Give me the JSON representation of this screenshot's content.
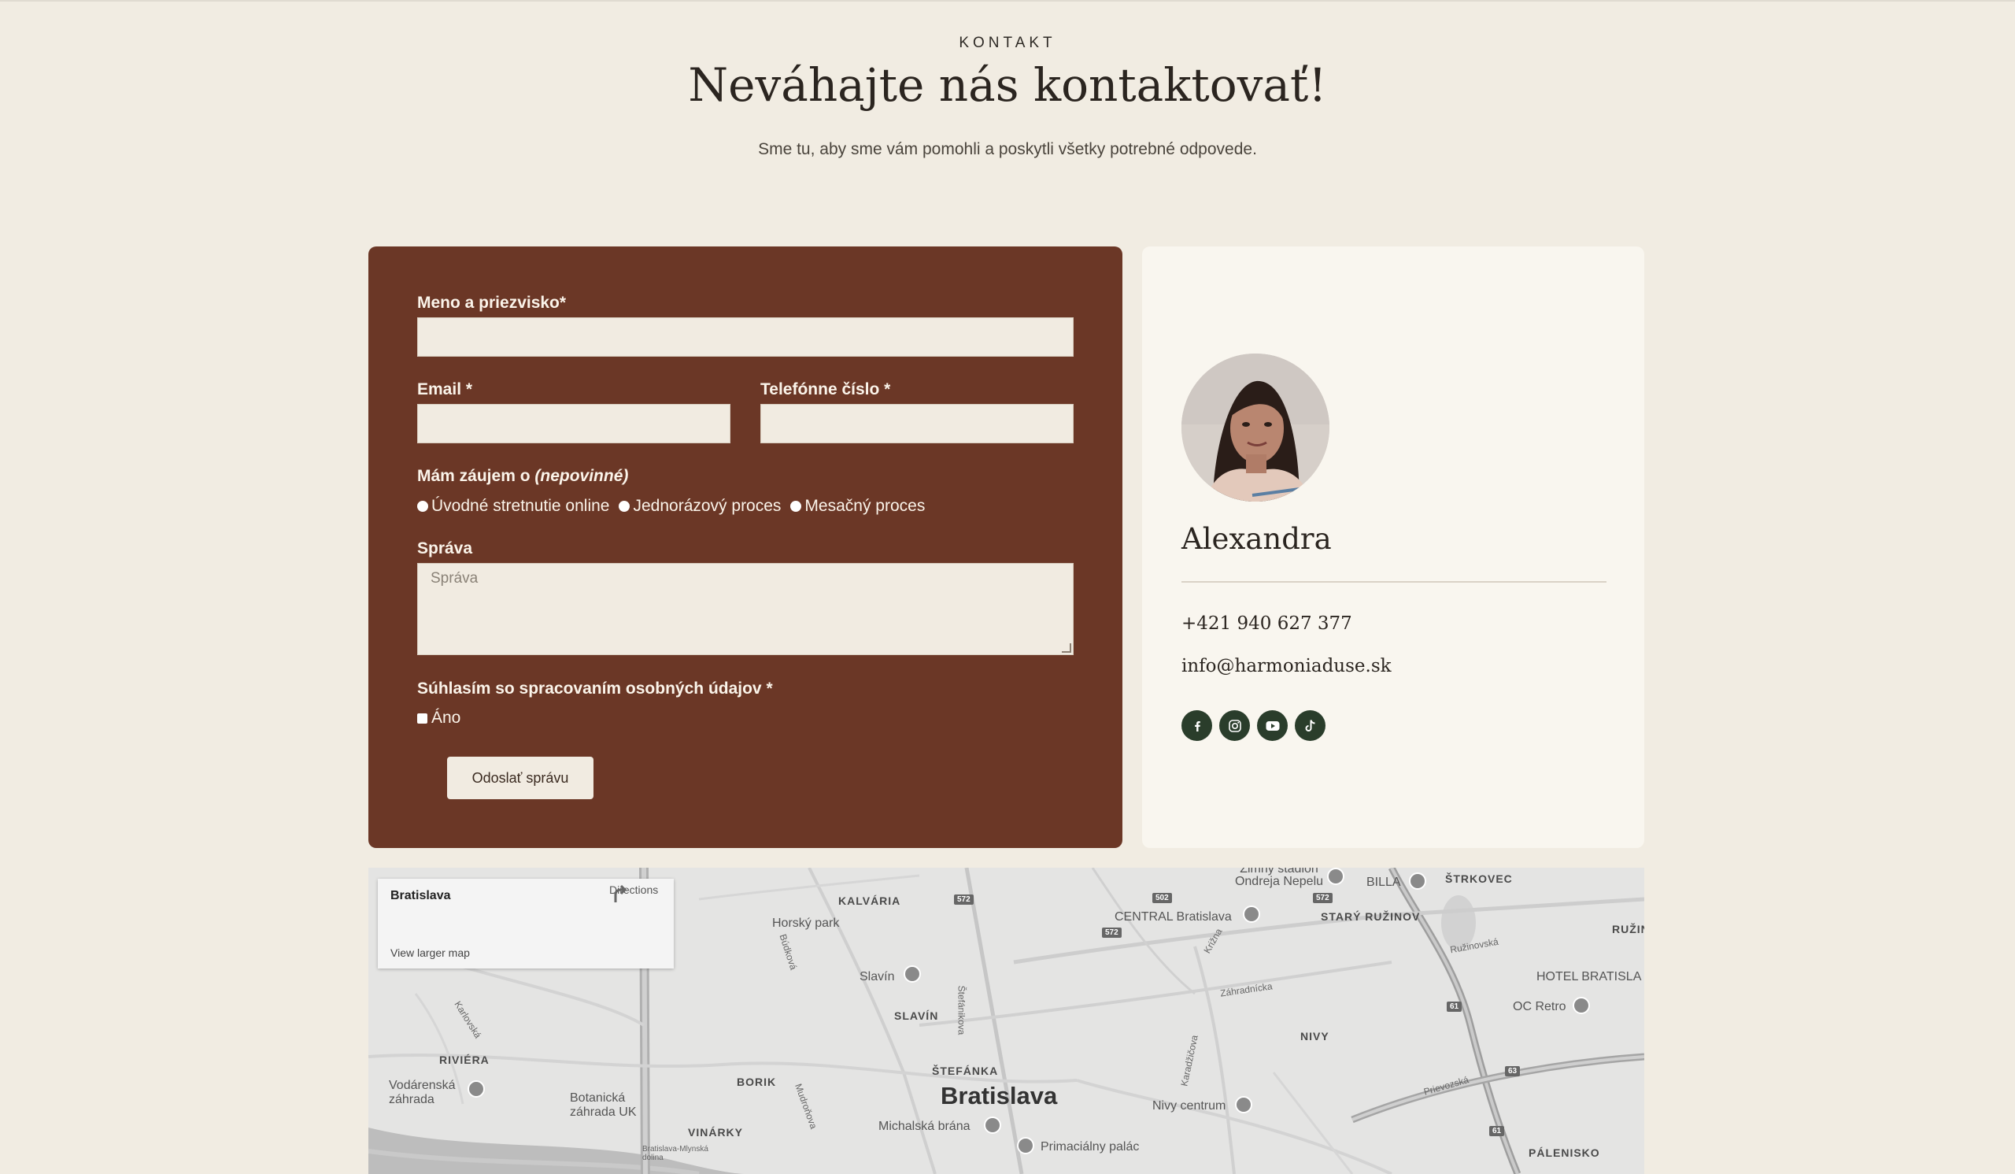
{
  "header": {
    "eyebrow": "KONTAKT",
    "title": "Neváhajte nás kontaktovať!",
    "subtitle": "Sme tu, aby sme vám pomohli a poskytli všetky potrebné odpovede."
  },
  "form": {
    "name_label": "Meno a priezvisko*",
    "name_value": "",
    "email_label": "Email *",
    "email_value": "",
    "phone_label": "Telefónne číslo *",
    "phone_value": "",
    "interest_label": "Mám záujem o",
    "interest_optional": "(nepovinné)",
    "interest_options": [
      "Úvodné stretnutie online",
      "Jednorázový proces",
      "Mesačný proces"
    ],
    "message_label": "Správa",
    "message_placeholder": "Správa",
    "consent_label": "Súhlasím so spracovaním osobných údajov *",
    "consent_option": "Áno",
    "submit_label": "Odoslať správu"
  },
  "profile": {
    "name": "Alexandra",
    "phone": "+421 940 627 377",
    "email": "info@harmoniaduse.sk",
    "socials": [
      "facebook-icon",
      "instagram-icon",
      "youtube-icon",
      "tiktok-icon"
    ]
  },
  "map": {
    "card_title": "Bratislava",
    "directions_label": "Directions",
    "larger_map_label": "View larger map",
    "districts": [
      "KALVÁRIA",
      "ŠTRKOVEC",
      "STARÝ RUŽINOV",
      "RUŽIN",
      "SLAVÍN",
      "RIVIÉRA",
      "BORIK",
      "ŠTEFÁNKA",
      "NIVY",
      "VINÁRKY",
      "PÁLENISKO"
    ],
    "city": "Bratislava",
    "pois": [
      "Horský park",
      "Slavín",
      "CENTRAL Bratislava",
      "Zimný štadión Ondreja Nepelu",
      "BILLA",
      "HOTEL BRATISLA",
      "OC Retro",
      "Vodárenská záhrada",
      "Botanická záhrada UK",
      "Nivy centrum",
      "Michalská brána",
      "Primaciálny palác",
      "Bratislava-Mlynská dolina"
    ],
    "roads": [
      "Búdková",
      "Štefánikova",
      "Križna",
      "Záhradnícka",
      "Ružinovská",
      "Karlovská",
      "Karadžičova",
      "Prievozská",
      "Mudroňova"
    ],
    "road_shields": [
      "572",
      "502",
      "572",
      "572",
      "61",
      "63",
      "61"
    ]
  },
  "colors": {
    "page_bg": "#f1ece2",
    "form_bg": "#6b3726",
    "profile_bg": "#f9f6ef",
    "social_bg": "#2a3d2b",
    "input_bg": "#f1ebe1"
  }
}
